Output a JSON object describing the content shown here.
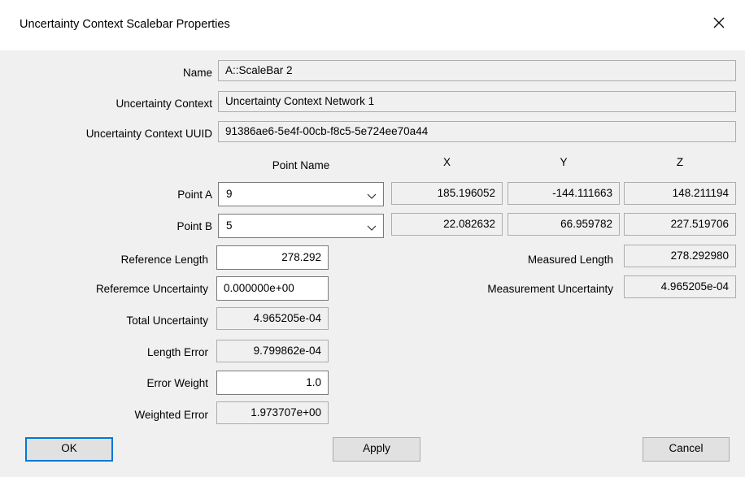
{
  "window": {
    "title": "Uncertainty Context Scalebar Properties",
    "close_icon": "close-icon"
  },
  "fields": {
    "name": {
      "label": "Name",
      "value": "A::ScaleBar 2"
    },
    "context": {
      "label": "Uncertainty Context",
      "value": "Uncertainty Context Network 1"
    },
    "uuid": {
      "label": "Uncertainty Context UUID",
      "value": "91386ae6-5e4f-00cb-f8c5-5e724ee70a44"
    }
  },
  "points": {
    "headers": {
      "name": "Point Name",
      "x": "X",
      "y": "Y",
      "z": "Z"
    },
    "a": {
      "label": "Point A",
      "name": "9",
      "x": "185.196052",
      "y": "-144.111663",
      "z": "148.211194"
    },
    "b": {
      "label": "Point B",
      "name": "5",
      "x": "22.082632",
      "y": "66.959782",
      "z": "227.519706"
    }
  },
  "lengths": {
    "reference_length": {
      "label": "Reference Length",
      "value": "278.292"
    },
    "reference_uncertainty": {
      "label": "Referemce Uncertainty",
      "value": "0.000000e+00"
    },
    "total_uncertainty": {
      "label": "Total Uncertainty",
      "value": "4.965205e-04"
    },
    "length_error": {
      "label": "Length Error",
      "value": "9.799862e-04"
    },
    "error_weight": {
      "label": "Error Weight",
      "value": "1.0"
    },
    "weighted_error": {
      "label": "Weighted Error",
      "value": "1.973707e+00"
    },
    "measured_length": {
      "label": "Measured Length",
      "value": "278.292980"
    },
    "measurement_uncertainty": {
      "label": "Measurement Uncertainty",
      "value": "4.965205e-04"
    }
  },
  "buttons": {
    "ok": "OK",
    "apply": "Apply",
    "cancel": "Cancel"
  },
  "colors": {
    "accent": "#0078d7",
    "background": "#f0f0f0",
    "titlebar": "#ffffff"
  }
}
